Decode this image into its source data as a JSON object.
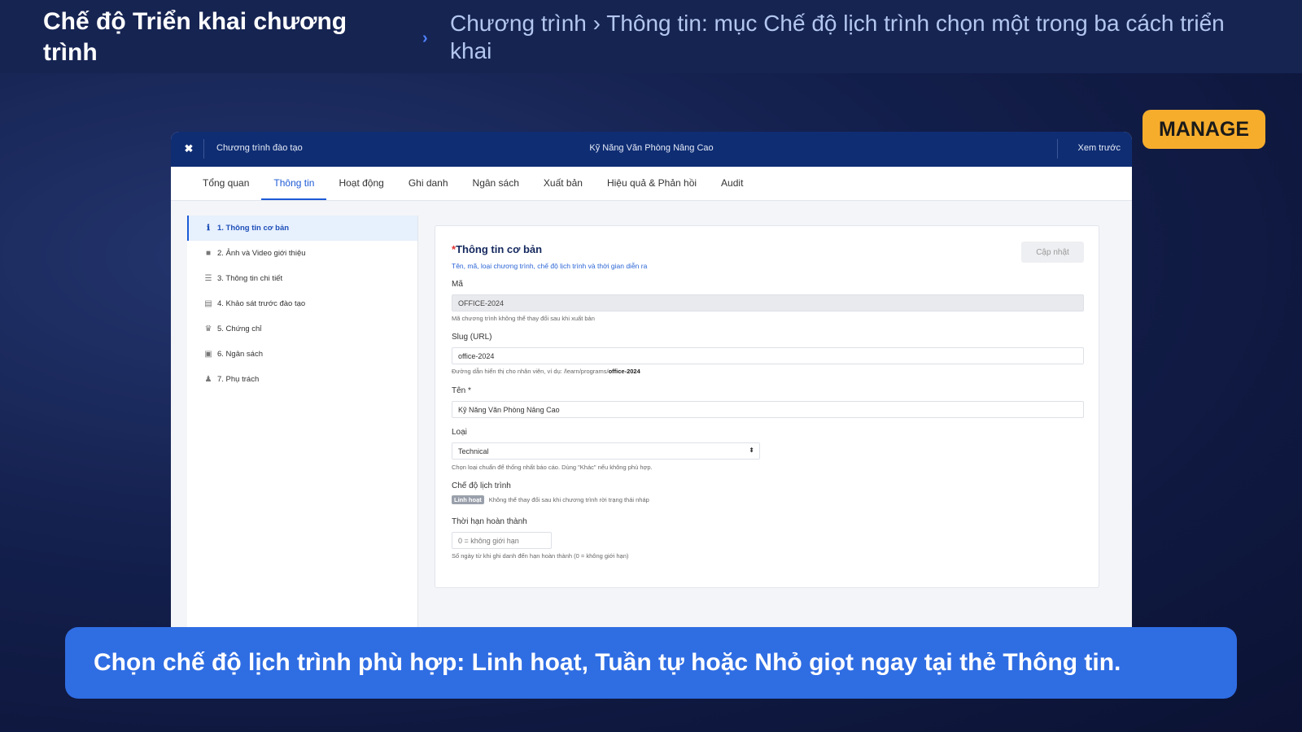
{
  "header": {
    "title": "Chế độ Triển khai chương trình",
    "chevron": "›",
    "description": "Chương trình › Thông tin: mục Chế độ lịch trình chọn một trong ba cách triển khai"
  },
  "badge": {
    "label": "MANAGE",
    "color": "#f7ad2c"
  },
  "app": {
    "close_icon": "✖",
    "breadcrumb": "Chương trình đào tạo",
    "title": "Kỹ Năng Văn Phòng Nâng Cao",
    "preview_label": "Xem trước",
    "tabs": [
      {
        "label": "Tổng quan",
        "active": false
      },
      {
        "label": "Thông tin",
        "active": true
      },
      {
        "label": "Hoạt động",
        "active": false
      },
      {
        "label": "Ghi danh",
        "active": false
      },
      {
        "label": "Ngân sách",
        "active": false
      },
      {
        "label": "Xuất bản",
        "active": false
      },
      {
        "label": "Hiệu quả & Phản hồi",
        "active": false
      },
      {
        "label": "Audit",
        "active": false
      }
    ],
    "sidebar": [
      {
        "label": "1. Thông tin cơ bản",
        "icon": "info-icon",
        "glyph": "ℹ",
        "active": true
      },
      {
        "label": "2. Ảnh và Video giới thiệu",
        "icon": "video-camera-icon",
        "glyph": "■",
        "active": false
      },
      {
        "label": "3. Thông tin chi tiết",
        "icon": "list-lines-icon",
        "glyph": "☰",
        "active": false
      },
      {
        "label": "4. Khảo sát trước đào tạo",
        "icon": "document-icon",
        "glyph": "▤",
        "active": false
      },
      {
        "label": "5. Chứng chỉ",
        "icon": "trophy-icon",
        "glyph": "♛",
        "active": false
      },
      {
        "label": "6. Ngân sách",
        "icon": "calendar-wallet-icon",
        "glyph": "▣",
        "active": false
      },
      {
        "label": "7. Phụ trách",
        "icon": "users-icon",
        "glyph": "♟",
        "active": false
      }
    ],
    "form": {
      "required_mark": "*",
      "title": "Thông tin cơ bản",
      "subtitle": "Tên, mã, loại chương trình, chế độ lịch trình và thời gian diễn ra",
      "update_button": "Cập nhật",
      "code": {
        "label": "Mã",
        "value": "OFFICE-2024",
        "hint": "Mã chương trình không thể thay đổi sau khi xuất bản"
      },
      "slug": {
        "label": "Slug (URL)",
        "value": "office-2024",
        "hint_prefix": "Đường dẫn hiển thị cho nhân viên, ví dụ: /learn/programs/",
        "hint_bold": "office-2024"
      },
      "name": {
        "label": "Tên *",
        "value": "Kỹ Năng Văn Phòng Nâng Cao"
      },
      "type": {
        "label": "Loại",
        "value": "Technical",
        "arrow": "⬍",
        "hint": "Chọn loại chuẩn để thống nhất báo cáo. Dùng \"Khác\" nếu không phù hợp."
      },
      "schedule_mode": {
        "label": "Chế độ lịch trình",
        "badge": "Linh hoạt",
        "note": "Không thể thay đổi sau khi chương trình rời trạng thái nháp"
      },
      "deadline": {
        "label": "Thời hạn hoàn thành",
        "placeholder": "0 = không giới hạn",
        "hint": "Số ngày từ khi ghi danh đến hạn hoàn thành (0 = không giới hạn)"
      }
    }
  },
  "caption": "Chọn chế độ lịch trình phù hợp: Linh hoạt, Tuần tự hoặc Nhỏ giọt ngay tại thẻ Thông tin."
}
